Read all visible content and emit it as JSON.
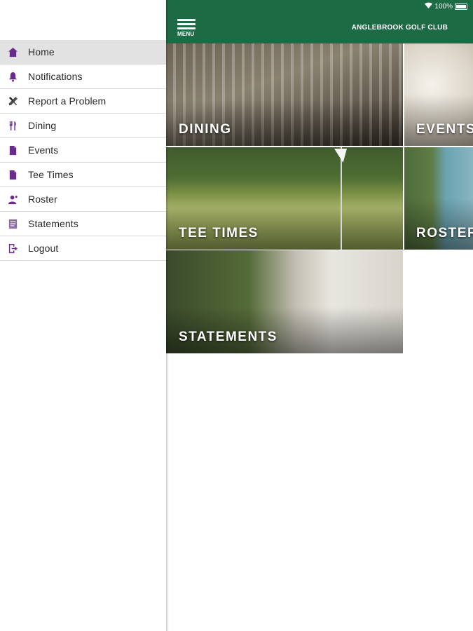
{
  "status_bar": {
    "battery": "100%",
    "wifi_icon": "wifi-icon",
    "battery_icon": "battery-icon"
  },
  "header": {
    "menu_label": "MENU",
    "title": "ANGLEBROOK GOLF CLUB",
    "background": "#1d6b45"
  },
  "sidebar": {
    "accent": "#6a2b8c",
    "items": [
      {
        "label": "Home",
        "icon": "home-icon",
        "active": true
      },
      {
        "label": "Notifications",
        "icon": "bell-icon"
      },
      {
        "label": "Report a Problem",
        "icon": "tools-icon"
      },
      {
        "label": "Dining",
        "icon": "utensils-icon"
      },
      {
        "label": "Events",
        "icon": "document-icon"
      },
      {
        "label": "Tee Times",
        "icon": "document-icon"
      },
      {
        "label": "Roster",
        "icon": "person-icon"
      },
      {
        "label": "Statements",
        "icon": "statement-icon"
      },
      {
        "label": "Logout",
        "icon": "logout-icon"
      }
    ]
  },
  "tiles": [
    {
      "label": "DINING"
    },
    {
      "label": "EVENTS"
    },
    {
      "label": "TEE TIMES"
    },
    {
      "label": "ROSTER"
    },
    {
      "label": "STATEMENTS"
    }
  ]
}
